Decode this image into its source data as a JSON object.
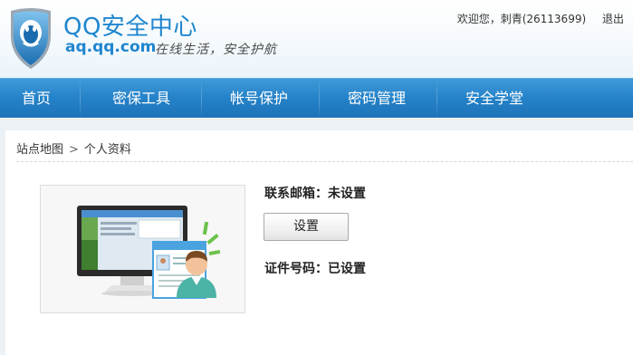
{
  "header": {
    "logo_title": "QQ安全中心",
    "logo_domain": "aq.qq.com",
    "slogan": "在线生活，安全护航",
    "welcome": "欢迎您，刺青(26113699)",
    "logout_label": "退出"
  },
  "nav": {
    "items": [
      {
        "label": "首页"
      },
      {
        "label": "密保工具"
      },
      {
        "label": "帐号保护"
      },
      {
        "label": "密码管理"
      },
      {
        "label": "安全学堂"
      }
    ]
  },
  "breadcrumb": {
    "root": "站点地图",
    "separator": ">",
    "current": "个人资料"
  },
  "profile": {
    "email_label": "联系邮箱：未设置",
    "set_button_label": "设置",
    "id_label": "证件号码：已设置"
  },
  "colors": {
    "brand_blue": "#1f86cf",
    "nav_blue": "#2582c8"
  },
  "icons": {
    "logo": "qq-shield-penguin-icon",
    "illustration": "computer-profile-illustration"
  }
}
